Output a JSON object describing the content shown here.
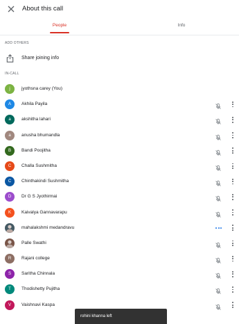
{
  "header": {
    "title": "About this call",
    "close_icon": "close-icon"
  },
  "tabs": [
    {
      "label": "People",
      "active": true
    },
    {
      "label": "Info",
      "active": false
    }
  ],
  "sections": {
    "add_others": "ADD OTHERS",
    "in_call": "IN-CALL"
  },
  "share": {
    "label": "Share joining info",
    "icon": "share-icon"
  },
  "colors": {
    "accent": "#d93025",
    "speaking": "#1a73e8"
  },
  "participants": [
    {
      "name": "jyothsna carey (You)",
      "initial": "j",
      "color": "#7cb342",
      "show_controls": false
    },
    {
      "name": "Akhila Payila",
      "initial": "A",
      "color": "#1e88e5",
      "show_controls": true
    },
    {
      "name": "akshitha lahari",
      "initial": "a",
      "color": "#00695c",
      "show_controls": true
    },
    {
      "name": "anusha bhumandla",
      "initial": "a",
      "color": "#a1887f",
      "show_controls": true
    },
    {
      "name": "Bandi Poojitha",
      "initial": "B",
      "color": "#33691e",
      "show_controls": true
    },
    {
      "name": "Challa Sushmitha",
      "initial": "C",
      "color": "#e64a19",
      "show_controls": true
    },
    {
      "name": "Chinthakindi Sushmitha",
      "initial": "C",
      "color": "#0b57a3",
      "show_controls": true
    },
    {
      "name": "Dr G S Jyothirmai",
      "initial": "D",
      "color": "#9c4dcc",
      "show_controls": true
    },
    {
      "name": "Kaivalya Gannavarapu",
      "initial": "K",
      "color": "#f4511e",
      "show_controls": true
    },
    {
      "name": "mahalakshmi medandravu",
      "initial": "",
      "color": "#455a64",
      "photo": true,
      "speaking": true,
      "show_controls": true
    },
    {
      "name": "Palle Swathi",
      "initial": "",
      "color": "#795548",
      "photo": true,
      "show_controls": true
    },
    {
      "name": "Rajani college",
      "initial": "R",
      "color": "#8d6e63",
      "show_controls": true
    },
    {
      "name": "Saritha Chinnala",
      "initial": "S",
      "color": "#8e24aa",
      "show_controls": true
    },
    {
      "name": "Thodishetty Pujitha",
      "initial": "T",
      "color": "#00897b",
      "show_controls": true
    },
    {
      "name": "Vaishnavi Kaspa",
      "initial": "V",
      "color": "#c2185b",
      "show_controls": true
    }
  ],
  "toast": {
    "message": "rohini khanna left"
  }
}
